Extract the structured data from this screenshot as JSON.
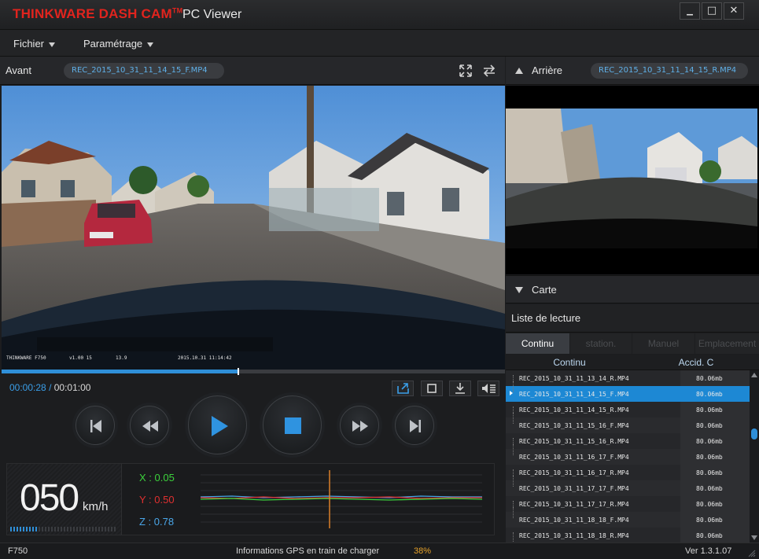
{
  "titlebar": {
    "brand": "THINKWARE DASH CAM",
    "trademark": "TM",
    "subtitle": "PC Viewer",
    "minimize": "▁",
    "maximize": "□",
    "close": "✕"
  },
  "menubar": {
    "fichier": "Fichier",
    "parametrage": "Paramétrage"
  },
  "front": {
    "label": "Avant",
    "file": "REC_2015_10_31_11_14_15_F.MP4",
    "overlay_left": "THINKWARE F750",
    "overlay_ver": "v1.00 15",
    "overlay_mid": "13.9",
    "overlay_date": "2015.10.31 11:14:42"
  },
  "rear": {
    "label": "Arrière",
    "file": "REC_2015_10_31_11_14_15_R.MP4"
  },
  "playback": {
    "current_time": "00:00:28",
    "separator": "/",
    "total_time": "00:01:00",
    "progress": 0.468
  },
  "gauge": {
    "speed": "050",
    "unit": "km/h",
    "x_label": "X : 0.05",
    "y_label": "Y : 0.50",
    "z_label": "Z : 0.78",
    "x_color": "#3cd23c",
    "y_color": "#e03030",
    "z_color": "#4aa6e8"
  },
  "carte": {
    "label": "Carte"
  },
  "playlist": {
    "title": "Liste de lecture",
    "tabs": [
      "Continu",
      "station.",
      "Manuel",
      "Emplacement"
    ],
    "columns": [
      "Continu",
      "Accid. C"
    ],
    "rows": [
      {
        "name": "REC_2015_10_31_11_13_14_R.MP4",
        "size": "80.06mb",
        "selected": false
      },
      {
        "name": "REC_2015_10_31_11_14_15_F.MP4",
        "size": "80.06mb",
        "selected": true
      },
      {
        "name": "REC_2015_10_31_11_14_15_R.MP4",
        "size": "80.06mb",
        "selected": false
      },
      {
        "name": "REC_2015_10_31_11_15_16_F.MP4",
        "size": "80.06mb",
        "selected": false
      },
      {
        "name": "REC_2015_10_31_11_15_16_R.MP4",
        "size": "80.06mb",
        "selected": false
      },
      {
        "name": "REC_2015_10_31_11_16_17_F.MP4",
        "size": "80.06mb",
        "selected": false
      },
      {
        "name": "REC_2015_10_31_11_16_17_R.MP4",
        "size": "80.06mb",
        "selected": false
      },
      {
        "name": "REC_2015_10_31_11_17_17_F.MP4",
        "size": "80.06mb",
        "selected": false
      },
      {
        "name": "REC_2015_10_31_11_17_17_R.MP4",
        "size": "80.06mb",
        "selected": false
      },
      {
        "name": "REC_2015_10_31_11_18_18_F.MP4",
        "size": "80.06mb",
        "selected": false
      },
      {
        "name": "REC_2015_10_31_11_18_18_R.MP4",
        "size": "80.06mb",
        "selected": false
      }
    ]
  },
  "status": {
    "model": "F750",
    "gps_text": "Informations GPS en train de charger",
    "gps_percent": "38%",
    "version": "Ver 1.3.1.07"
  },
  "colors": {
    "accent": "#2f8fd8",
    "selected_row": "#1d88d4",
    "brand_red": "#e1241e"
  }
}
